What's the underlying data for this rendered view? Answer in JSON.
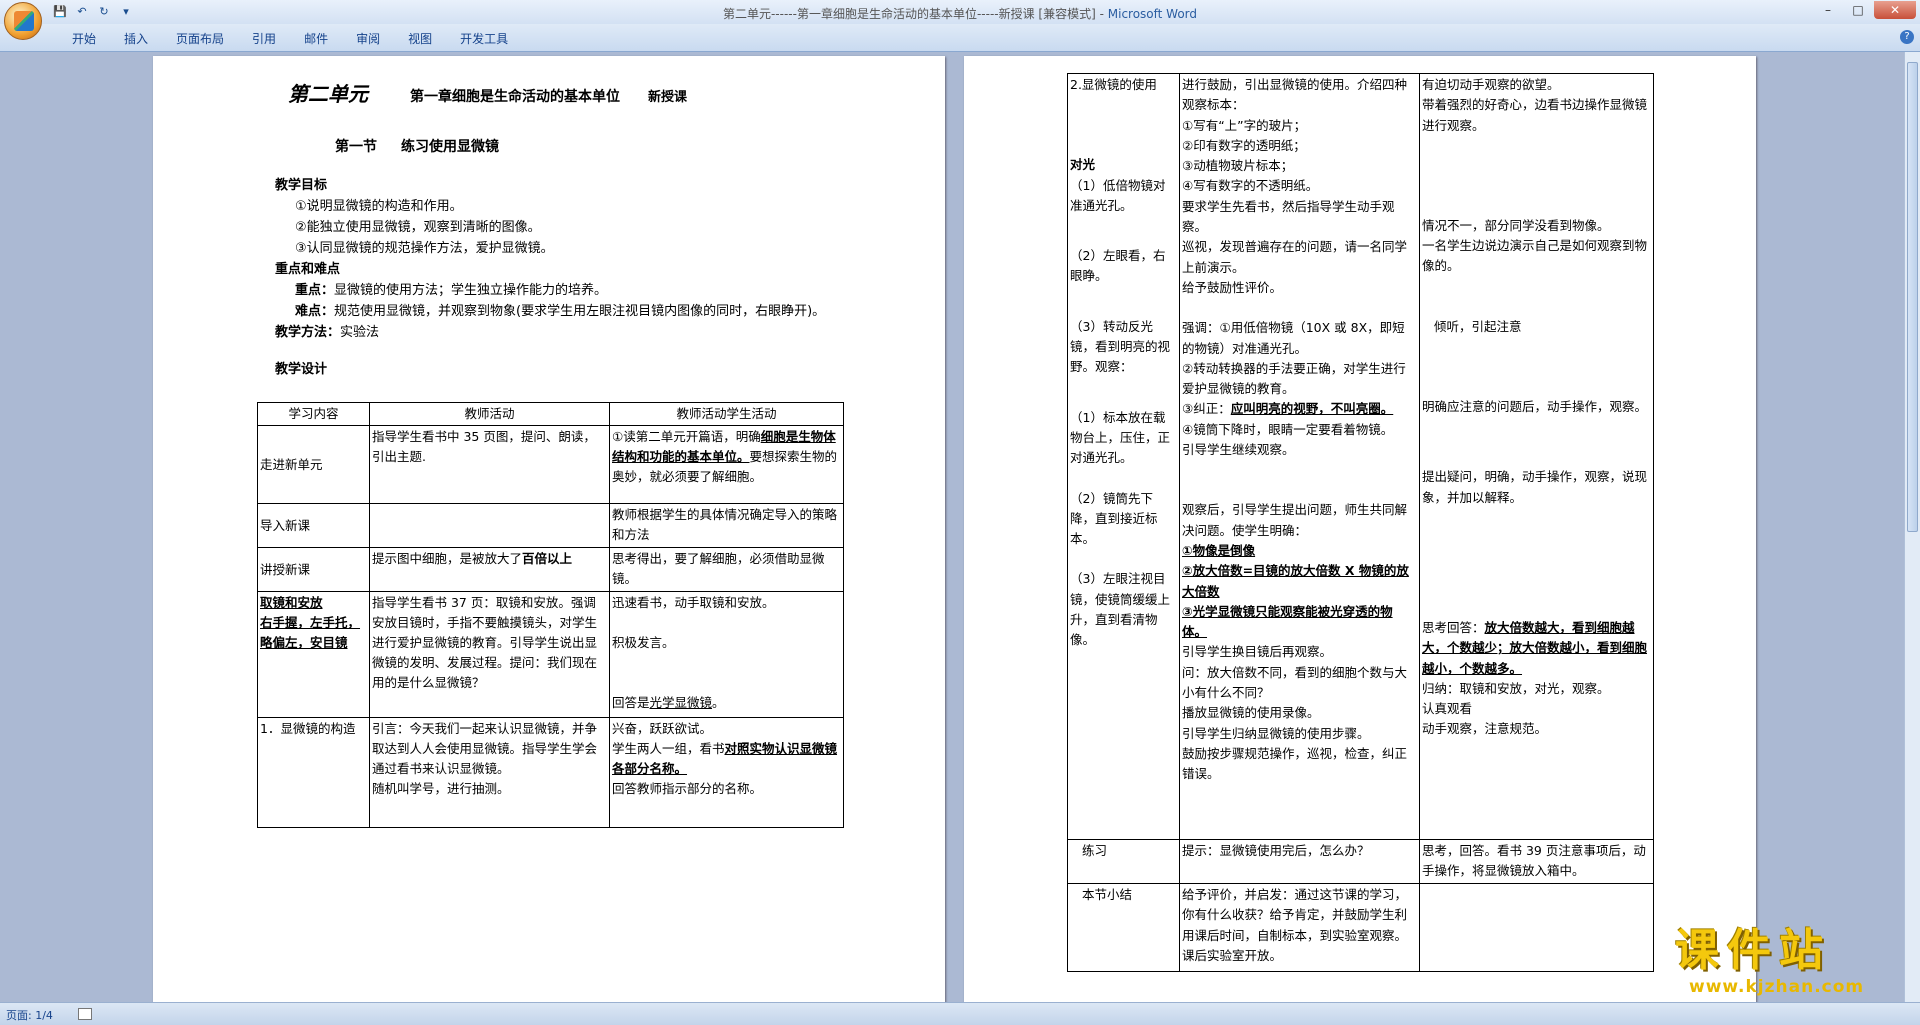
{
  "window": {
    "title_prefix": "第二单元------第一章细胞是生命活动的基本单位-----新授课 [兼容模式] - ",
    "title_app": "Microsoft Word",
    "minimize": "–",
    "maximize": "□",
    "close": "✕"
  },
  "ribbon": {
    "tabs": [
      "开始",
      "插入",
      "页面布局",
      "引用",
      "邮件",
      "审阅",
      "视图",
      "开发工具"
    ],
    "help": "?"
  },
  "quick_access": {
    "save": "💾",
    "undo": "↶",
    "redo": "↻",
    "more": "▾"
  },
  "page1": {
    "unit": "第二单元",
    "chapter": "第一章细胞是生命活动的基本单位",
    "lesson_type": "新授课",
    "section_no": "第一节",
    "section_title": "练习使用显微镜",
    "goals_heading": "教学目标",
    "goal1": "①说明显微镜的构造和作用。",
    "goal2": "②能独立使用显微镜，观察到清晰的图像。",
    "goal3": "③认同显微镜的规范操作方法，爱护显微镜。",
    "keypoints_heading": "重点和难点",
    "key_label": "重点：",
    "key_text": "显微镜的使用方法；学生独立操作能力的培养。",
    "diff_label": "难点：",
    "diff_text": "规范使用显微镜，并观察到物象(要求学生用左眼注视目镜内图像的同时，右眼睁开)。",
    "method_label": "教学方法：",
    "method_text": "实验法",
    "design_heading": "教学设计",
    "table_headers": [
      "学习内容",
      "教师活动",
      "教师活动学生活动"
    ],
    "rows": [
      {
        "c1": "走进新单元",
        "c2": "指导学生看书中 35 页图，提问、朗读，引出主题.",
        "c3a": "①读第二单元开篇语，明确",
        "c3b": "细胞是生物体结构和功能的基本单位。",
        "c3c": "要想探索生物的奥妙，就必须要了解细胞。"
      },
      {
        "c1": "导入新课",
        "c2": "",
        "c3": "教师根据学生的具体情况确定导入的策略和方法"
      },
      {
        "c1": "讲授新课",
        "c2a": "提示图中细胞，是被放大了",
        "c2b": "百倍以上",
        "c3": "思考得出，要了解细胞，必须借助显微镜。"
      },
      {
        "c1a": "取镜和安放",
        "c1b": "右手握，左手托，略偏左，安目镜",
        "c2": "指导学生看书 37 页：取镜和安放。强调安放目镜时，手指不要触摸镜头，对学生进行爱护显微镜的教育。引导学生说出显微镜的发明、发展过程。提问：我们现在用的是什么显微镜？",
        "c3a": "迅速看书，动手取镜和安放。",
        "c3b": "积极发言。",
        "c3c": "回答是",
        "c3d": "光学显微镜",
        "c3e": "。"
      },
      {
        "c1": "1．显微镜的构造",
        "c2a": "引言：今天我们一起来认识显微镜，并争取达到人人会使用显微镜。指导学生学会通过看书来认识显微镜。",
        "c2b": "随机叫学号，进行抽测。",
        "c3a": "兴奋，跃跃欲试。",
        "c3b": "学生两人一组，看书",
        "c3c": "对照实物认识显微镜各部分名称。",
        "c3d": "回答教师指示部分的名称。"
      }
    ]
  },
  "page2": {
    "r1c1": "2.显微镜的使用",
    "r1c1b": "对光",
    "r1c1c": "（1）低倍物镜对准通光孔。",
    "r1c1d": "（2）左眼看，右眼睁。",
    "r1c1e": "（3）转动反光镜，看到明亮的视野。观察：",
    "r1c1f": "（1）标本放在载物台上，压住，正对通光孔。",
    "r1c1g": "（2）镜筒先下降，直到接近标本。",
    "r1c1h": "（3）左眼注视目镜，使镜筒缓缓上升，直到看清物像。",
    "r1c2": [
      "进行鼓励，引出显微镜的使用。介绍四种观察标本：",
      "①写有“上”字的玻片；",
      "②印有数字的透明纸；",
      "③动植物玻片标本；",
      "④写有数字的不透明纸。",
      "要求学生先看书，然后指导学生动手观察。",
      "巡视，发现普遍存在的问题，请一名同学上前演示。",
      "给予鼓励性评价。",
      "强调：①用低倍物镜（10X 或 8X，即短的物镜）对准通光孔。",
      "②转动转换器的手法要正确，对学生进行爱护显微镜的教育。",
      "③纠正：",
      "应叫明亮的视野，不叫亮圈。",
      "④镜筒下降时，眼睛一定要看着物镜。",
      "引导学生继续观察。",
      "观察后，引导学生提出问题，师生共同解决问题。使学生明确：",
      "①物像是倒像",
      "②放大倍数=目镜的放大倍数 X 物镜的放大倍数",
      "③光学显微镜只能观察能被光穿透的物体。",
      "引导学生换目镜后再观察。",
      "问：放大倍数不同，看到的细胞个数与大小有什么不同？",
      "播放显微镜的使用录像。",
      "引导学生归纳显微镜的使用步骤。",
      "鼓励按步骤规范操作，巡视，检查，纠正错误。"
    ],
    "r1c3": [
      "有迫切动手观察的欲望。",
      "带着强烈的好奇心，边看书边操作显微镜进行观察。",
      "情况不一，部分同学没看到物像。",
      "一名学生边说边演示自己是如何观察到物像的。",
      "倾听，引起注意",
      "明确应注意的问题后，动手操作，观察。",
      "提出疑问，明确，动手操作，观察，说现象，并加以解释。",
      "思考回答：",
      "放大倍数越大，看到细胞越大，个数越少；放大倍数越小，看到细胞越小，个数越多。",
      "归纳：取镜和安放，对光，观察。",
      "认真观看",
      "动手观察，注意规范。"
    ],
    "r2c1": "练习",
    "r2c2": "提示：显微镜使用完后，怎么办？",
    "r2c3": "思考，回答。看书 39 页注意事项后，动手操作，将显微镜放入箱中。",
    "r3c1": "本节小结",
    "r3c2": "给予评价，并启发：通过这节课的学习，你有什么收获？给予肯定，并鼓励学生利用课后时间，自制标本，到实验室观察。课后实验室开放。",
    "r3c3": ""
  },
  "status": {
    "page": "页面: 1/4"
  },
  "watermark": {
    "title": "课件站",
    "url": "www.kjzhan.com"
  }
}
